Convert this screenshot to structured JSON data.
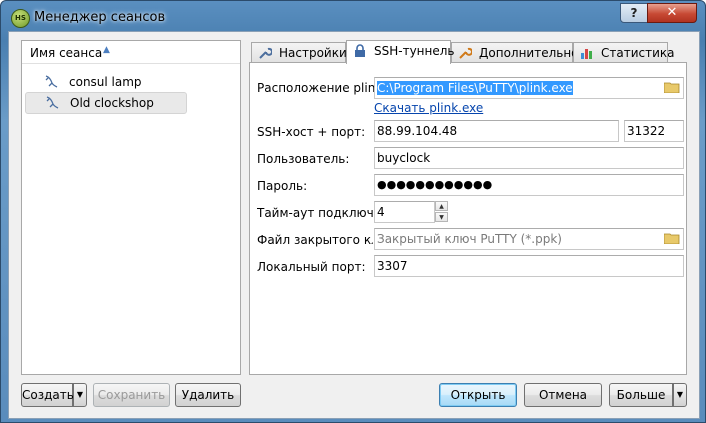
{
  "window": {
    "title": "Менеджер сеансов",
    "help_label": "?",
    "close_label": "✕",
    "app_icon_text": "HS"
  },
  "session_list": {
    "header": "Имя сеанса",
    "items": [
      {
        "label": "consul lamp"
      },
      {
        "label": "Old clockshop",
        "selected": true
      }
    ]
  },
  "tabs": [
    {
      "label": "Настройки",
      "icon": "wrench-icon"
    },
    {
      "label": "SSH-туннель",
      "icon": "lock-icon",
      "active": true
    },
    {
      "label": "Дополнительно",
      "icon": "wrench-orange-icon"
    },
    {
      "label": "Статистика",
      "icon": "bar-chart-icon"
    }
  ],
  "form": {
    "plink_label": "Расположение plink.exe:",
    "plink_value": "C:\\Program Files\\PuTTY\\plink.exe",
    "download_link": "Скачать plink.exe",
    "ssh_host_label": "SSH-хост + порт:",
    "ssh_host_value": "88.99.104.48",
    "ssh_port_value": "31322",
    "user_label": "Пользователь:",
    "user_value": "buyclock",
    "password_label": "Пароль:",
    "password_value": "●●●●●●●●●●●●",
    "timeout_label": "Тайм-аут подключения:",
    "timeout_value": "4",
    "keyfile_label": "Файл закрытого ключа:",
    "keyfile_placeholder": "Закрытый ключ PuTTY (*.ppk)",
    "local_port_label": "Локальный порт:",
    "local_port_value": "3307"
  },
  "buttons": {
    "create": "Создать",
    "save": "Сохранить",
    "delete": "Удалить",
    "open": "Открыть",
    "cancel": "Отмена",
    "more": "Больше"
  }
}
